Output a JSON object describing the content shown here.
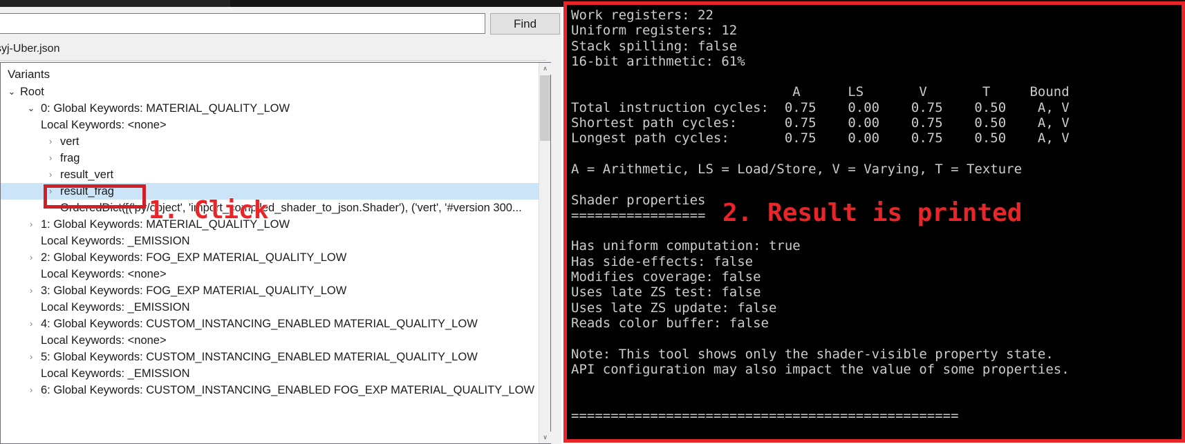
{
  "window": {
    "title_strip": ""
  },
  "search": {
    "value": "",
    "placeholder": "",
    "find_label": "Find"
  },
  "file_tab": {
    "label": "syj-Uber.json"
  },
  "tree": {
    "header": "Variants",
    "rows": [
      {
        "indent": 0,
        "arrow": "open",
        "label": "Root",
        "selected": false
      },
      {
        "indent": 1,
        "arrow": "open",
        "label": "0: Global Keywords: MATERIAL_QUALITY_LOW",
        "selected": false
      },
      {
        "indent": 1,
        "arrow": "none",
        "label": "Local Keywords: <none>",
        "selected": false
      },
      {
        "indent": 2,
        "arrow": "closed",
        "label": "vert",
        "selected": false
      },
      {
        "indent": 2,
        "arrow": "closed",
        "label": "frag",
        "selected": false
      },
      {
        "indent": 2,
        "arrow": "closed",
        "label": "result_vert",
        "selected": false
      },
      {
        "indent": 2,
        "arrow": "closed",
        "label": "result_frag",
        "selected": true
      },
      {
        "indent": 2,
        "arrow": "none",
        "label": "OrderedDict([('py/object', 'import_compiled_shader_to_json.Shader'), ('vert', '#version 300...",
        "selected": false
      },
      {
        "indent": 1,
        "arrow": "closed",
        "label": "1: Global Keywords: MATERIAL_QUALITY_LOW",
        "selected": false
      },
      {
        "indent": 1,
        "arrow": "none",
        "label": "Local Keywords: _EMISSION",
        "selected": false
      },
      {
        "indent": 1,
        "arrow": "closed",
        "label": "2: Global Keywords: FOG_EXP MATERIAL_QUALITY_LOW",
        "selected": false
      },
      {
        "indent": 1,
        "arrow": "none",
        "label": "Local Keywords: <none>",
        "selected": false
      },
      {
        "indent": 1,
        "arrow": "closed",
        "label": "3: Global Keywords: FOG_EXP MATERIAL_QUALITY_LOW",
        "selected": false
      },
      {
        "indent": 1,
        "arrow": "none",
        "label": "Local Keywords: _EMISSION",
        "selected": false
      },
      {
        "indent": 1,
        "arrow": "closed",
        "label": "4: Global Keywords: CUSTOM_INSTANCING_ENABLED MATERIAL_QUALITY_LOW",
        "selected": false
      },
      {
        "indent": 1,
        "arrow": "none",
        "label": "Local Keywords: <none>",
        "selected": false
      },
      {
        "indent": 1,
        "arrow": "closed",
        "label": "5: Global Keywords: CUSTOM_INSTANCING_ENABLED MATERIAL_QUALITY_LOW",
        "selected": false
      },
      {
        "indent": 1,
        "arrow": "none",
        "label": "Local Keywords: _EMISSION",
        "selected": false
      },
      {
        "indent": 1,
        "arrow": "closed",
        "label": "6: Global Keywords: CUSTOM_INSTANCING_ENABLED FOG_EXP MATERIAL_QUALITY_LOW",
        "selected": false
      }
    ],
    "scrollbar": {
      "up_arrow": "∧",
      "down_arrow": "∨"
    }
  },
  "terminal": {
    "lines": [
      "Work registers: 22",
      "Uniform registers: 12",
      "Stack spilling: false",
      "16-bit arithmetic: 61%",
      "",
      "                            A      LS       V       T     Bound",
      "Total instruction cycles:  0.75    0.00    0.75    0.50    A, V",
      "Shortest path cycles:      0.75    0.00    0.75    0.50    A, V",
      "Longest path cycles:       0.75    0.00    0.75    0.50    A, V",
      "",
      "A = Arithmetic, LS = Load/Store, V = Varying, T = Texture",
      "",
      "Shader properties",
      "=================",
      "",
      "Has uniform computation: true",
      "Has side-effects: false",
      "Modifies coverage: false",
      "Uses late ZS test: false",
      "Uses late ZS update: false",
      "Reads color buffer: false",
      "",
      "Note: This tool shows only the shader-visible property state.",
      "API configuration may also impact the value of some properties.",
      "",
      "",
      "================================================="
    ],
    "stats": {
      "work_registers": "22",
      "uniform_registers": "12",
      "stack_spilling": "false",
      "bit16_arithmetic": "61%"
    },
    "cycles_table": {
      "columns": [
        "A",
        "LS",
        "V",
        "T",
        "Bound"
      ],
      "rows": [
        {
          "label": "Total instruction cycles:",
          "A": "0.75",
          "LS": "0.00",
          "V": "0.75",
          "T": "0.50",
          "Bound": "A, V"
        },
        {
          "label": "Shortest path cycles:",
          "A": "0.75",
          "LS": "0.00",
          "V": "0.75",
          "T": "0.50",
          "Bound": "A, V"
        },
        {
          "label": "Longest path cycles:",
          "A": "0.75",
          "LS": "0.00",
          "V": "0.75",
          "T": "0.50",
          "Bound": "A, V"
        }
      ],
      "legend": "A = Arithmetic, LS = Load/Store, V = Varying, T = Texture"
    },
    "shader_properties": {
      "title": "Shader properties",
      "items": [
        {
          "name": "Has uniform computation",
          "value": "true"
        },
        {
          "name": "Has side-effects",
          "value": "false"
        },
        {
          "name": "Modifies coverage",
          "value": "false"
        },
        {
          "name": "Uses late ZS test",
          "value": "false"
        },
        {
          "name": "Uses late ZS update",
          "value": "false"
        },
        {
          "name": "Reads color buffer",
          "value": "false"
        }
      ]
    },
    "note": "Note: This tool shows only the shader-visible property state. API configuration may also impact the value of some properties."
  },
  "annotations": {
    "step1": "1. Click",
    "step2": "2. Result is printed",
    "color": "#e8262a"
  }
}
